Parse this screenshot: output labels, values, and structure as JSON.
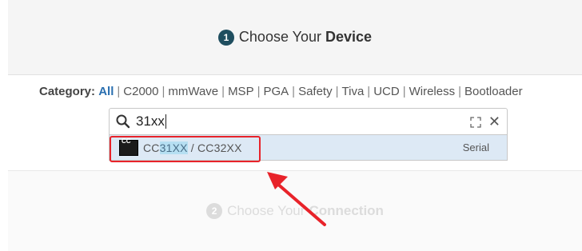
{
  "step1": {
    "number": "1",
    "title_prefix": "Choose Your",
    "title_emphasis": "Device"
  },
  "category": {
    "label": "Category:",
    "items": [
      "All",
      "C2000",
      "mmWave",
      "MSP",
      "PGA",
      "Safety",
      "Tiva",
      "UCD",
      "Wireless",
      "Bootloader"
    ],
    "active": "All"
  },
  "search": {
    "value": "31xx",
    "expand_icon": "expand-icon",
    "clear_icon": "close-icon"
  },
  "result": {
    "icon_tag": "CC",
    "name_before": "CC",
    "name_match": "31XX",
    "name_after": " / CC32XX",
    "type": "Serial"
  },
  "step2": {
    "number": "2",
    "title_prefix": "Choose Your",
    "title_emphasis": "Connection"
  },
  "colors": {
    "highlight": "#e8232a",
    "accent": "#2a6fb0",
    "step_badge": "#1f4e5f"
  }
}
